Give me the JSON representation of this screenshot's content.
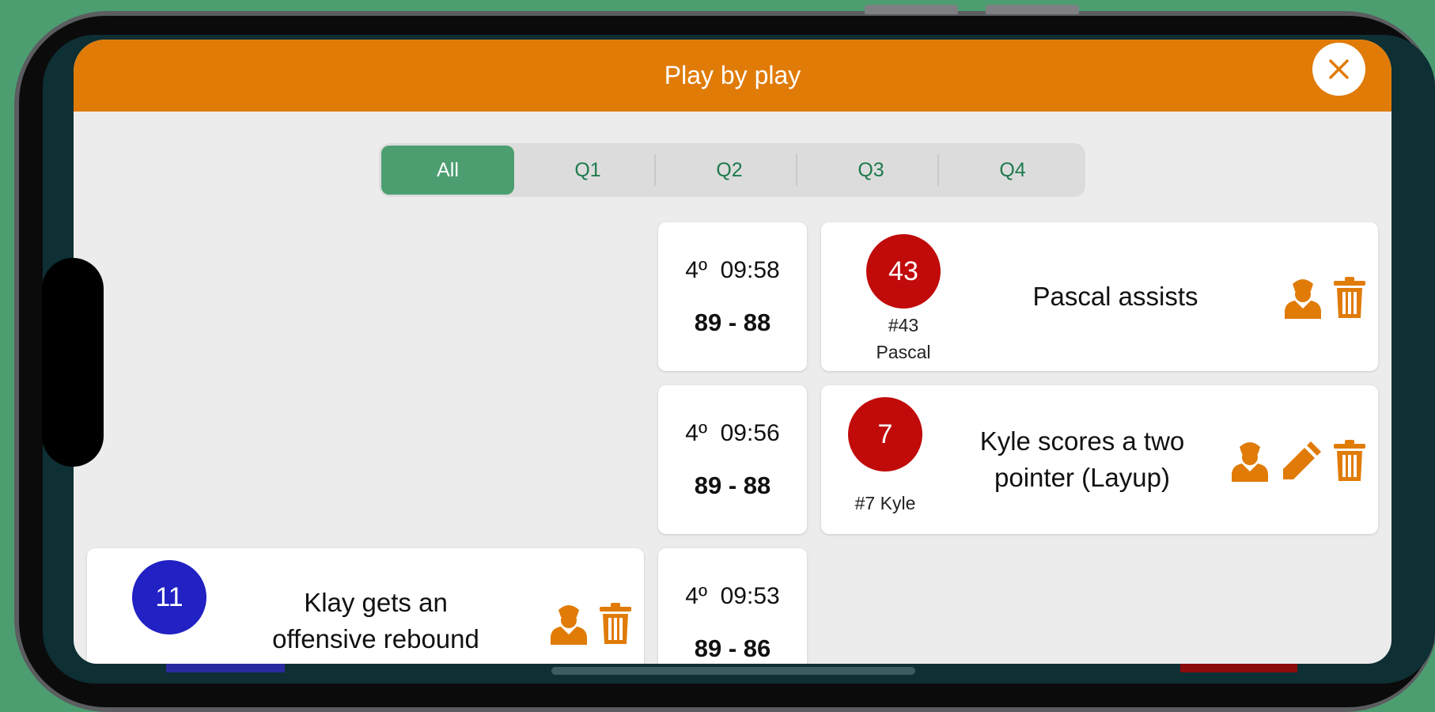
{
  "header": {
    "title": "Play by play",
    "close_icon": "close-icon"
  },
  "filters": [
    {
      "label": "All",
      "active": true
    },
    {
      "label": "Q1",
      "active": false
    },
    {
      "label": "Q2",
      "active": false
    },
    {
      "label": "Q3",
      "active": false
    },
    {
      "label": "Q4",
      "active": false
    }
  ],
  "plays": [
    {
      "clock": "4º  09:58",
      "score": "89 - 88",
      "side": "right",
      "number": "43",
      "player_line1": "#43",
      "player_line2": "Pascal",
      "description": "Pascal assists",
      "badge_color": "#c10a0a",
      "actions": [
        "player-icon",
        "trash-icon"
      ]
    },
    {
      "clock": "4º  09:56",
      "score": "89 - 88",
      "side": "right",
      "number": "7",
      "player_line1": "#7 Kyle",
      "player_line2": "",
      "description_line1": "Kyle scores a two",
      "description_line2": "pointer (Layup)",
      "badge_color": "#c10a0a",
      "actions": [
        "player-icon",
        "pencil-icon",
        "trash-icon"
      ]
    },
    {
      "clock": "4º  09:53",
      "score": "89 - 86",
      "side": "left",
      "number": "11",
      "description_line1": "Klay gets an",
      "description_line2": "offensive rebound",
      "badge_color": "#2121c4",
      "actions": [
        "player-icon",
        "trash-icon"
      ]
    }
  ],
  "colors": {
    "accent": "#e07b08",
    "green": "#4c9e71",
    "home": "#c10a0a",
    "away": "#2121c4"
  }
}
